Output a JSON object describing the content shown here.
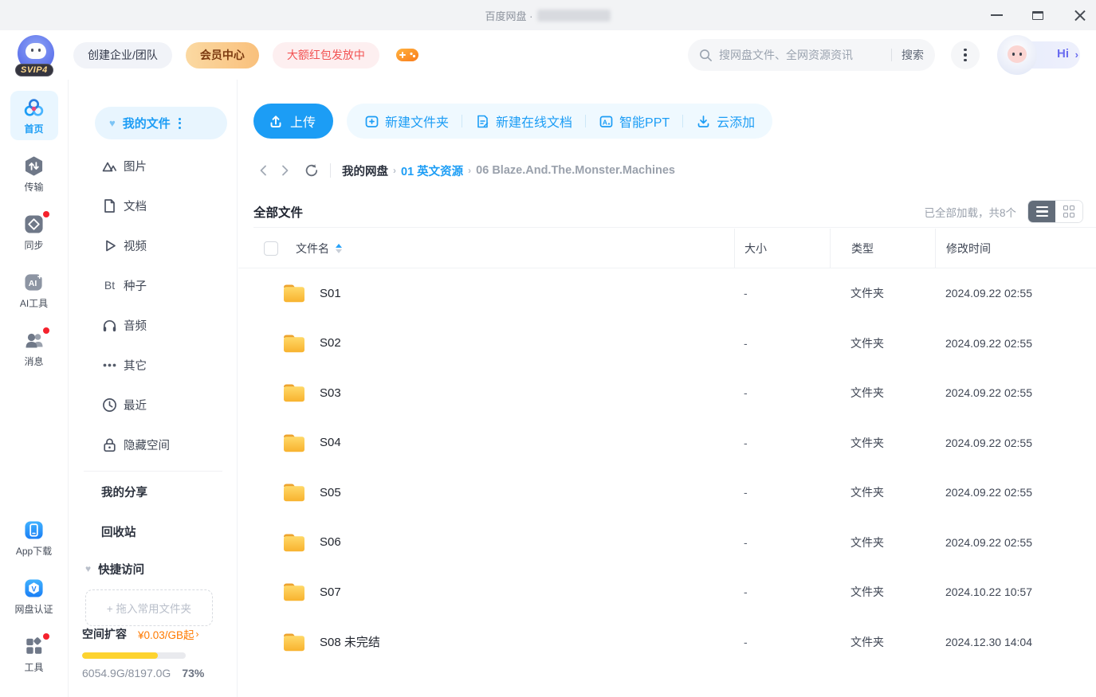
{
  "titlebar": {
    "title": "百度网盘 ·"
  },
  "header": {
    "svip_badge": "SVIP4",
    "create_team_label": "创建企业/团队",
    "member_center_label": "会员中心",
    "red_packet_label": "大额红包发放中",
    "search_placeholder": "搜网盘文件、全网资源资讯",
    "search_button_label": "搜索",
    "greeting_label": "Hi",
    "greeting_arrow": "›"
  },
  "nav": {
    "home": "首页",
    "transfer": "传输",
    "sync": "同步",
    "ai_tools": "AI工具",
    "messages": "消息",
    "app_download": "App下载",
    "certification": "网盘认证",
    "tools": "工具"
  },
  "sidebar": {
    "my_files_label": "我的文件",
    "cat_images": "图片",
    "cat_docs": "文档",
    "cat_videos": "视频",
    "cat_torrents": "种子",
    "torrent_icon_text": "Bt",
    "cat_audio": "音频",
    "cat_other": "其它",
    "cat_recent": "最近",
    "cat_hidden": "隐藏空间",
    "my_shares_label": "我的分享",
    "recycle_label": "回收站",
    "quick_access_label": "快捷访问",
    "drop_hint": "+ 拖入常用文件夹",
    "storage": {
      "expand_label": "空间扩容",
      "price_label": "¥0.03/GB起",
      "price_arrow": "›",
      "usage": "6054.9G/8197.0G",
      "percent_label": "73%",
      "percent": 73
    }
  },
  "toolbar": {
    "upload_label": "上传",
    "new_folder_label": "新建文件夹",
    "new_doc_label": "新建在线文档",
    "smart_ppt_label": "智能PPT",
    "cloud_add_label": "云添加"
  },
  "breadcrumb": {
    "root": "我的网盘",
    "sep": "›",
    "parent": "01 英文资源",
    "current": "06 Blaze.And.The.Monster.Machines"
  },
  "filelist": {
    "title": "全部文件",
    "load_status": "已全部加载，共8个",
    "col_name": "文件名",
    "col_size": "大小",
    "col_type": "类型",
    "col_modified": "修改时间",
    "rows": [
      {
        "name": "S01",
        "size": "-",
        "type": "文件夹",
        "modified": "2024.09.22 02:55"
      },
      {
        "name": "S02",
        "size": "-",
        "type": "文件夹",
        "modified": "2024.09.22 02:55"
      },
      {
        "name": "S03",
        "size": "-",
        "type": "文件夹",
        "modified": "2024.09.22 02:55"
      },
      {
        "name": "S04",
        "size": "-",
        "type": "文件夹",
        "modified": "2024.09.22 02:55"
      },
      {
        "name": "S05",
        "size": "-",
        "type": "文件夹",
        "modified": "2024.09.22 02:55"
      },
      {
        "name": "S06",
        "size": "-",
        "type": "文件夹",
        "modified": "2024.09.22 02:55"
      },
      {
        "name": "S07",
        "size": "-",
        "type": "文件夹",
        "modified": "2024.10.22 10:57"
      },
      {
        "name": "S08 未完结",
        "size": "-",
        "type": "文件夹",
        "modified": "2024.12.30 14:04"
      }
    ]
  },
  "colors": {
    "accent_blue": "#1c9df5",
    "folder_yellow_top": "#ffd968",
    "folder_yellow_bottom": "#f8b32f",
    "progress_yellow": "#fdd32f",
    "price_orange": "#ff7a00",
    "badge_red": "#f5222d",
    "member_gradient": "#fbd9a2"
  }
}
